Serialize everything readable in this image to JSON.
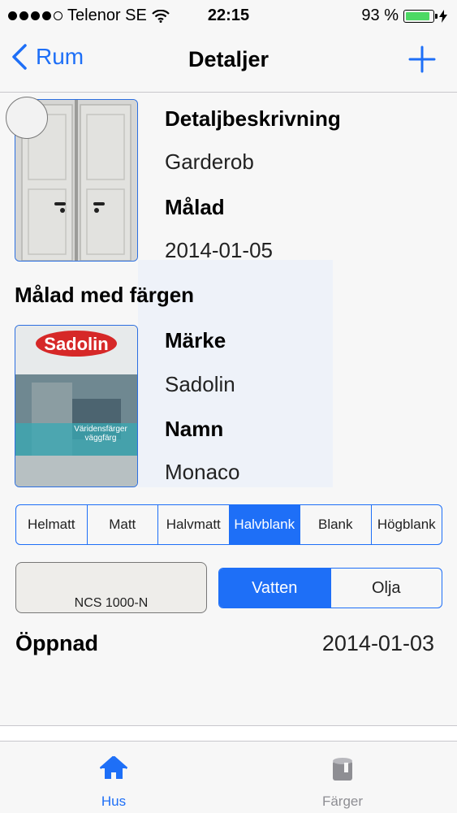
{
  "status_bar": {
    "carrier": "Telenor SE",
    "time": "22:15",
    "battery_percent": "93 %",
    "battery_level": 0.93
  },
  "nav": {
    "back_label": "Rum",
    "title": "Detaljer",
    "add_icon": "plus-icon"
  },
  "detail": {
    "description_label": "Detaljbeskrivning",
    "description_value": "Garderob",
    "painted_label": "Målad",
    "painted_value": "2014-01-05",
    "photo_icon": "wardrobe-door-photo"
  },
  "paint": {
    "section_title": "Målad med färgen",
    "brand_label": "Märke",
    "brand_value": "Sadolin",
    "name_label": "Namn",
    "name_value": "Monaco",
    "can_logo_text": "Sadolin",
    "can_sub_text": "Väridensfärger väggfärg"
  },
  "gloss": {
    "options": [
      "Helmatt",
      "Matt",
      "Halvmatt",
      "Halvblank",
      "Blank",
      "Högblank"
    ],
    "selected": "Halvblank"
  },
  "color_code": "NCS 1000-N",
  "base": {
    "options": [
      "Vatten",
      "Olja"
    ],
    "selected": "Vatten"
  },
  "opened": {
    "label": "Öppnad",
    "value": "2014-01-03"
  },
  "tabs": [
    {
      "label": "Hus",
      "icon": "house-icon",
      "active": true
    },
    {
      "label": "Färger",
      "icon": "paint-can-icon",
      "active": false
    }
  ],
  "colors": {
    "accent": "#1e6ff7",
    "battery": "#4cd964",
    "inactive_tab": "#8e8e93"
  }
}
